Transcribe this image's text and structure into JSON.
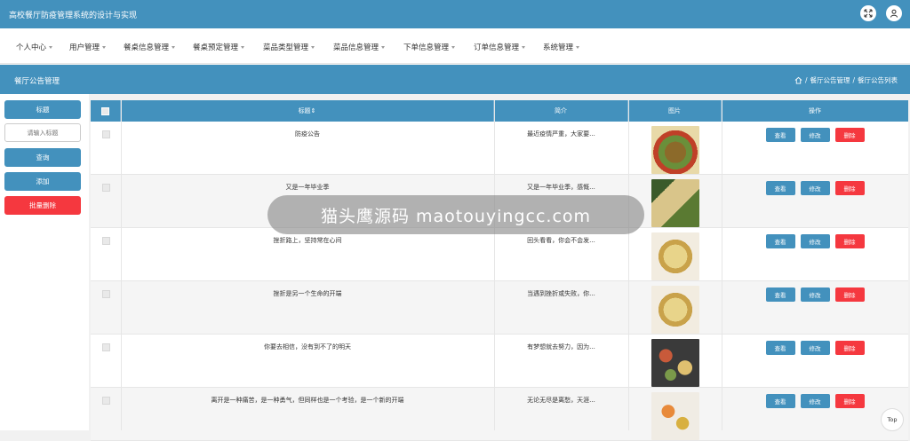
{
  "app": {
    "title": "高校餐厅防疫管理系统的设计与实现"
  },
  "topbar_icons": [
    "fullscreen-icon",
    "user-icon"
  ],
  "nav": [
    {
      "label": "个人中心"
    },
    {
      "label": "用户管理"
    },
    {
      "label": "餐桌信息管理"
    },
    {
      "label": "餐桌预定管理"
    },
    {
      "label": "菜品类型管理"
    },
    {
      "label": "菜品信息管理"
    },
    {
      "label": "下单信息管理"
    },
    {
      "label": "订单信息管理"
    },
    {
      "label": "系统管理"
    }
  ],
  "page": {
    "title": "餐厅公告管理",
    "breadcrumb": [
      "餐厅公告管理",
      "餐厅公告列表"
    ],
    "breadcrumb_sep": "/"
  },
  "sidebar": {
    "title_label": "标题",
    "search_placeholder": "请输入标题",
    "query_label": "查询",
    "add_label": "添加",
    "batch_delete_label": "批量删除"
  },
  "table": {
    "columns": [
      "标题",
      "简介",
      "图片",
      "操作"
    ],
    "sort_mark": "⇕",
    "actions": {
      "view": "查看",
      "edit": "修改",
      "delete": "删除"
    },
    "rows": [
      {
        "title": "防疫公告",
        "intro": "最近疫情严重，大家要...",
        "image": "food-1"
      },
      {
        "title": "又是一年毕业季",
        "intro": "又是一年毕业季，感慨...",
        "image": "food-2"
      },
      {
        "title": "挫折路上，坚持常在心间",
        "intro": "回头看看，你会不会发...",
        "image": "food-3"
      },
      {
        "title": "挫折是另一个生命的开端",
        "intro": "当遇到挫折或失败，你...",
        "image": "food-3"
      },
      {
        "title": "你要去相信，没有到不了的明天",
        "intro": "有梦想就去努力，因为...",
        "image": "food-4"
      },
      {
        "title": "离开是一种痛苦，是一种勇气，但同样也是一个考验，是一个新的开端",
        "intro": "无论无尽是离愁，天涯...",
        "image": "food-5"
      }
    ]
  },
  "watermark": "猫头鹰源码  maotouyingcc.com",
  "top_button": "Top",
  "colors": {
    "primary": "#4391bd",
    "danger": "#f5383f"
  }
}
